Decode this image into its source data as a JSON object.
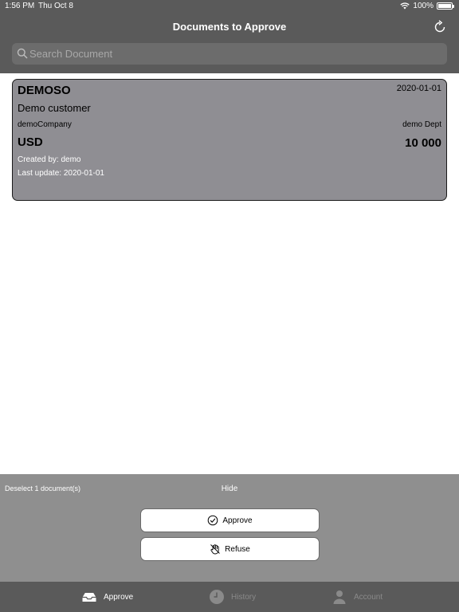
{
  "status_bar": {
    "time": "1:56 PM",
    "date": "Thu Oct 8",
    "battery": "100%",
    "battery_level": 1.0,
    "wifi_icon": "wifi-icon"
  },
  "header": {
    "title": "Documents to Approve",
    "refresh_icon": "refresh-icon"
  },
  "search": {
    "placeholder": "Search Document",
    "icon": "search-icon"
  },
  "documents": [
    {
      "id": "DEMOSO",
      "date": "2020-01-01",
      "customer": "Demo customer",
      "company": "demoCompany",
      "department": "demo Dept",
      "currency": "USD",
      "amount": "10 000",
      "created_by": "Created by: demo",
      "last_update": "Last update: 2020-01-01",
      "selected": true
    }
  ],
  "actions": {
    "deselect": "Deselect 1 document(s)",
    "hide": "Hide",
    "approve_label": "Approve",
    "refuse_label": "Refuse"
  },
  "tabs": [
    {
      "label": "Approve",
      "icon": "inbox-icon",
      "active": true
    },
    {
      "label": "History",
      "icon": "clock-icon",
      "active": false
    },
    {
      "label": "Account",
      "icon": "person-icon",
      "active": false
    }
  ],
  "colors": {
    "header_bg": "#5a5a5a",
    "card_bg": "#8f8e93",
    "panel_bg": "#8f8f8f",
    "tab_active": "#ffffff",
    "tab_inactive": "#8a8a8a"
  }
}
